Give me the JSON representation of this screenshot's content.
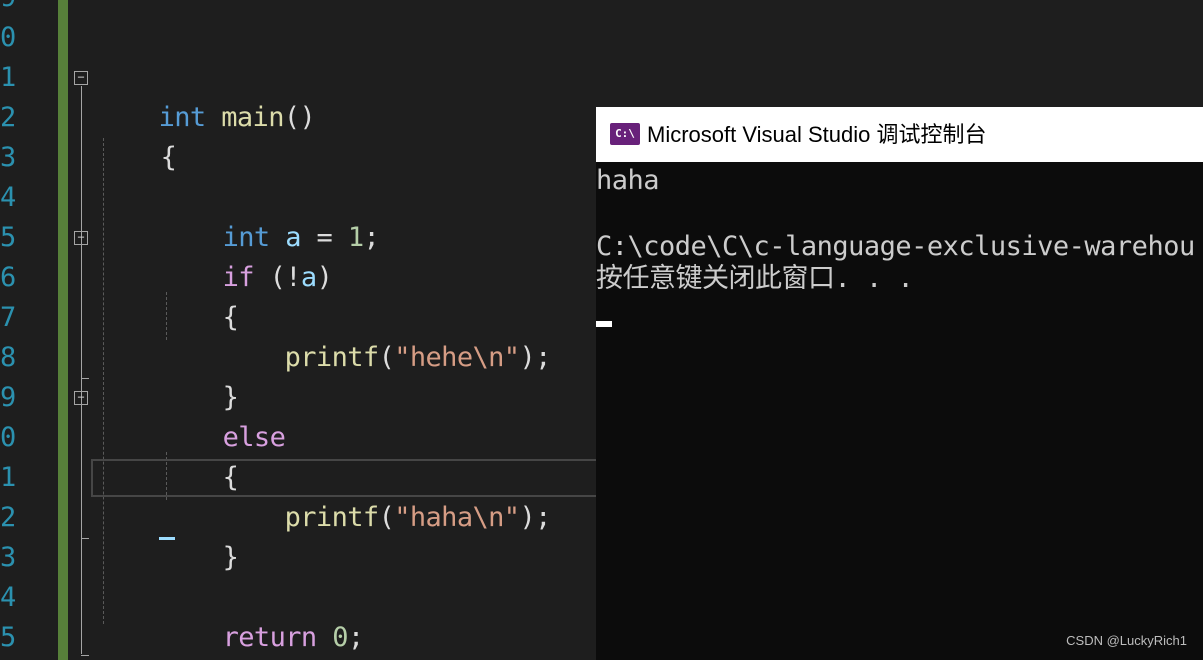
{
  "editor": {
    "line_numbers": [
      "9",
      "0",
      "1",
      "2",
      "3",
      "4",
      "5",
      "6",
      "7",
      "8",
      "9",
      "0",
      "1",
      "2",
      "3",
      "4",
      "5"
    ],
    "fold_marker": "−",
    "lines": {
      "l11": {
        "t1": "int",
        "t2": " ",
        "t3": "main",
        "t4": "()"
      },
      "l12": {
        "t1": "{"
      },
      "l14": {
        "t1": "int",
        "t2": " ",
        "t3": "a",
        "t4": " = ",
        "t5": "1",
        "t6": ";"
      },
      "l15": {
        "t1": "if",
        "t2": " (!",
        "t3": "a",
        "t4": ")"
      },
      "l16": {
        "t1": "{"
      },
      "l17": {
        "t1": "printf",
        "t2": "(",
        "t3": "\"hehe\\n\"",
        "t4": ");"
      },
      "l18": {
        "t1": "}"
      },
      "l19": {
        "t1": "else"
      },
      "l20": {
        "t1": "{"
      },
      "l21": {
        "t1": "printf",
        "t2": "(",
        "t3": "\"haha\\n\"",
        "t4": ");"
      },
      "l22": {
        "t1": "}"
      },
      "l24": {
        "t1": "return",
        "t2": " ",
        "t3": "0",
        "t4": ";"
      },
      "l25": {
        "t1": "}"
      }
    }
  },
  "console": {
    "title": "Microsoft Visual Studio 调试控制台",
    "icon_label": "C:\\",
    "icon": "console-app-icon",
    "output": [
      "haha",
      "",
      "C:\\code\\C\\c-language-exclusive-warehou",
      "按任意键关闭此窗口. . ."
    ]
  },
  "watermark": "CSDN @LuckyRich1",
  "colors": {
    "background": "#1e1e1e",
    "line_number": "#2b91af",
    "keyword": "#569cd6",
    "control_keyword": "#d8a0df",
    "function": "#dcdcaa",
    "variable": "#9cdcfe",
    "number": "#b5cea8",
    "string": "#d69d85",
    "change_bar": "#57803a",
    "console_bg": "#0c0c0c",
    "console_icon": "#68217a"
  }
}
